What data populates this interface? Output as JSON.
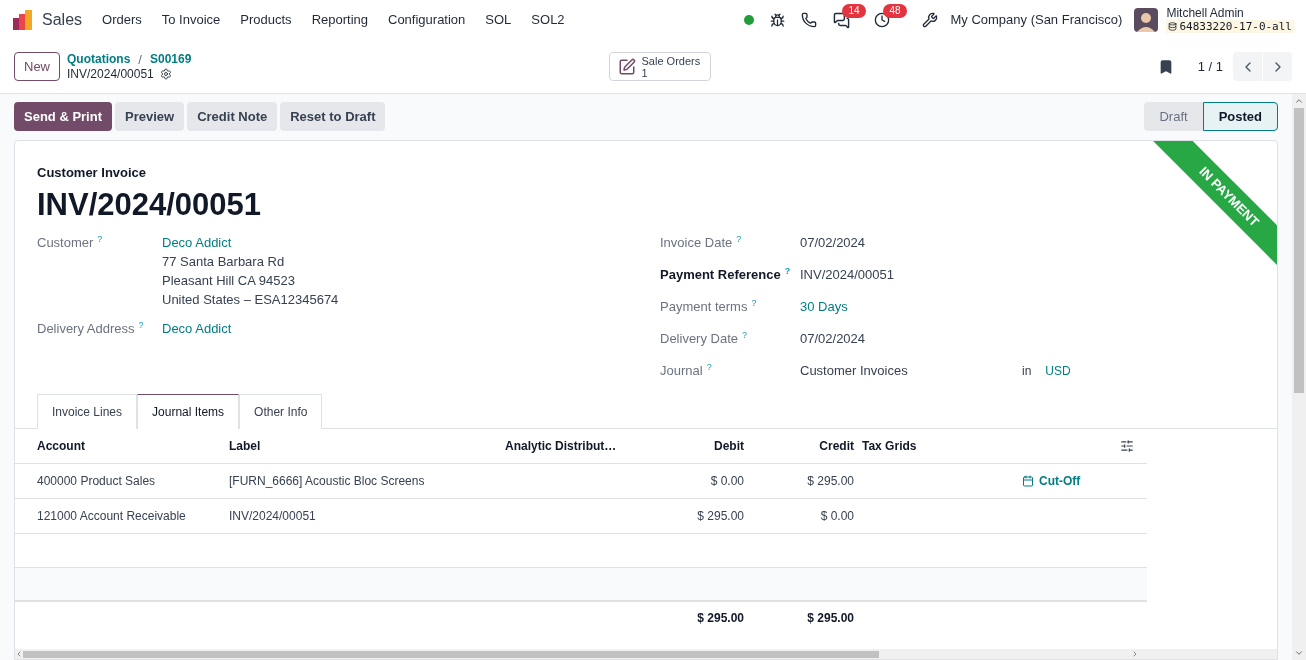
{
  "navbar": {
    "app": "Sales",
    "menu": [
      "Orders",
      "To Invoice",
      "Products",
      "Reporting",
      "Configuration",
      "SOL",
      "SOL2"
    ],
    "messages_count": "14",
    "activities_count": "48",
    "company": "My Company (San Francisco)",
    "user": "Mitchell Admin",
    "database": "64833220-17-0-all"
  },
  "control_panel": {
    "new_button": "New",
    "breadcrumbs": [
      "Quotations",
      "S00169"
    ],
    "breadcrumb_separator": "/",
    "record": "INV/2024/00051",
    "smart_button": {
      "label": "Sale Orders",
      "count": "1"
    },
    "pager": "1 / 1"
  },
  "actions": [
    {
      "label": "Send & Print",
      "primary": true
    },
    {
      "label": "Preview",
      "primary": false
    },
    {
      "label": "Credit Note",
      "primary": false
    },
    {
      "label": "Reset to Draft",
      "primary": false
    }
  ],
  "stages": [
    {
      "label": "Draft",
      "selected": false
    },
    {
      "label": "Posted",
      "selected": true
    }
  ],
  "sheet": {
    "ribbon": "IN PAYMENT",
    "type_label": "Customer Invoice",
    "number": "INV/2024/00051",
    "left_fields": [
      {
        "label": "Customer",
        "value": "Deco Addict",
        "link": true,
        "address": [
          "77 Santa Barbara Rd",
          "Pleasant Hill CA 94523",
          "United States – ESA12345674"
        ]
      },
      {
        "label": "Delivery Address",
        "value": "Deco Addict",
        "link": true
      }
    ],
    "right_fields": [
      {
        "label": "Invoice Date",
        "value": "07/02/2024",
        "link": false,
        "bold": false
      },
      {
        "label": "Payment Reference",
        "value": "INV/2024/00051",
        "link": false,
        "bold": true
      },
      {
        "label": "Payment terms",
        "value": "30 Days",
        "link": true,
        "bold": false
      },
      {
        "label": "Delivery Date",
        "value": "07/02/2024",
        "link": false,
        "bold": false
      },
      {
        "label": "Journal",
        "value": "Customer Invoices",
        "link": false,
        "bold": false,
        "in_label": "in",
        "currency": "USD"
      }
    ],
    "help_mark": "?",
    "tabs": [
      {
        "label": "Invoice Lines",
        "selected": false
      },
      {
        "label": "Journal Items",
        "selected": true
      },
      {
        "label": "Other Info",
        "selected": false
      }
    ],
    "table": {
      "columns": [
        "Account",
        "Label",
        "Analytic Distribut…",
        "Debit",
        "Credit",
        "Tax Grids"
      ],
      "rows": [
        {
          "account": "400000 Product Sales",
          "label": "[FURN_6666] Acoustic Bloc Screens",
          "debit": "$ 0.00",
          "credit": "$ 295.00",
          "action": "Cut-Off"
        },
        {
          "account": "121000 Account Receivable",
          "label": "INV/2024/00051",
          "debit": "$ 295.00",
          "credit": "$ 0.00"
        }
      ],
      "totals": {
        "debit": "$ 295.00",
        "credit": "$ 295.00"
      }
    }
  }
}
